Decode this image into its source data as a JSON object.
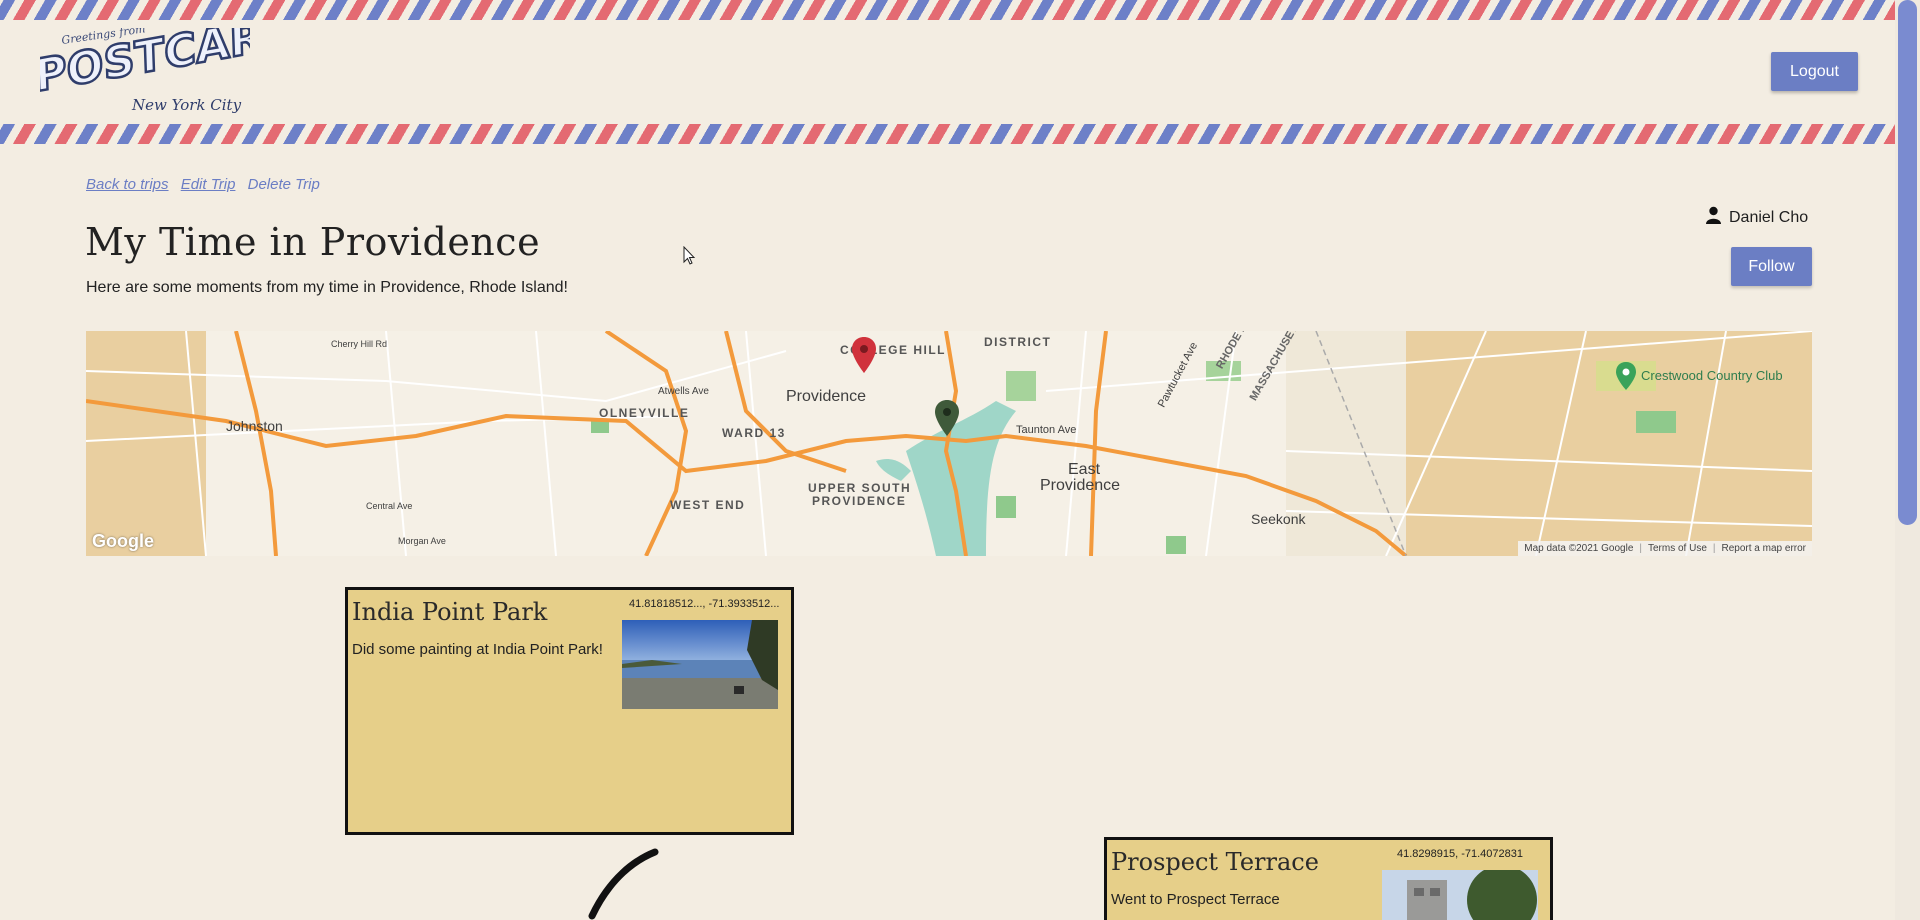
{
  "header": {
    "logo_text_top": "Greetings from",
    "logo_text_main": "POSTCARD",
    "logo_text_sub": "New York City",
    "logout_label": "Logout"
  },
  "trip_nav": {
    "back_label": "Back to trips",
    "edit_label": "Edit Trip",
    "delete_label": "Delete Trip"
  },
  "trip": {
    "title": "My Time in Providence",
    "description": "Here are some moments from my time in Providence, Rhode Island!"
  },
  "user": {
    "name": "Daniel Cho",
    "follow_label": "Follow"
  },
  "map": {
    "labels": {
      "johnston": "Johnston",
      "olneyville": "OLNEYVILLE",
      "providence": "Providence",
      "ward13": "WARD 13",
      "west_end": "WEST END",
      "upper_south_1": "UPPER SOUTH",
      "upper_south_2": "PROVIDENCE",
      "college_hill": "COLLEGE HILL",
      "district": "DISTRICT",
      "east_providence_1": "East",
      "east_providence_2": "Providence",
      "seekonk": "Seekonk",
      "crestwood": "Crestwood Country Club",
      "massachusetts": "MASSACHUSETTS",
      "rhode_island": "RHODE IS",
      "taunton_ave": "Taunton Ave",
      "pawtucket_ave": "Pawtucket Ave",
      "atwells": "Atwells Ave",
      "cherry_hill": "Cherry Hill Rd",
      "morgan": "Morgan Ave",
      "central": "Central Ave"
    },
    "google": "Google",
    "footer": {
      "data": "Map data ©2021 Google",
      "terms": "Terms of Use",
      "report": "Report a map error"
    },
    "colors": {
      "land": "#e9cfa0",
      "road": "#f39a3c",
      "water": "#9fd6c8",
      "park": "#b8d9a6"
    }
  },
  "postcards": [
    {
      "title": "India Point Park",
      "coords": "41.81818512..., -71.3933512...",
      "text": "Did some painting at India Point Park!"
    },
    {
      "title": "Prospect Terrace",
      "coords": "41.8298915, -71.4072831",
      "text": "Went to Prospect Terrace"
    }
  ],
  "colors": {
    "background": "#f3ede2",
    "accent": "#6b7ec4",
    "card": "#e6cf89",
    "stripe_red": "#e46a72",
    "stripe_blue": "#6d80c8"
  }
}
